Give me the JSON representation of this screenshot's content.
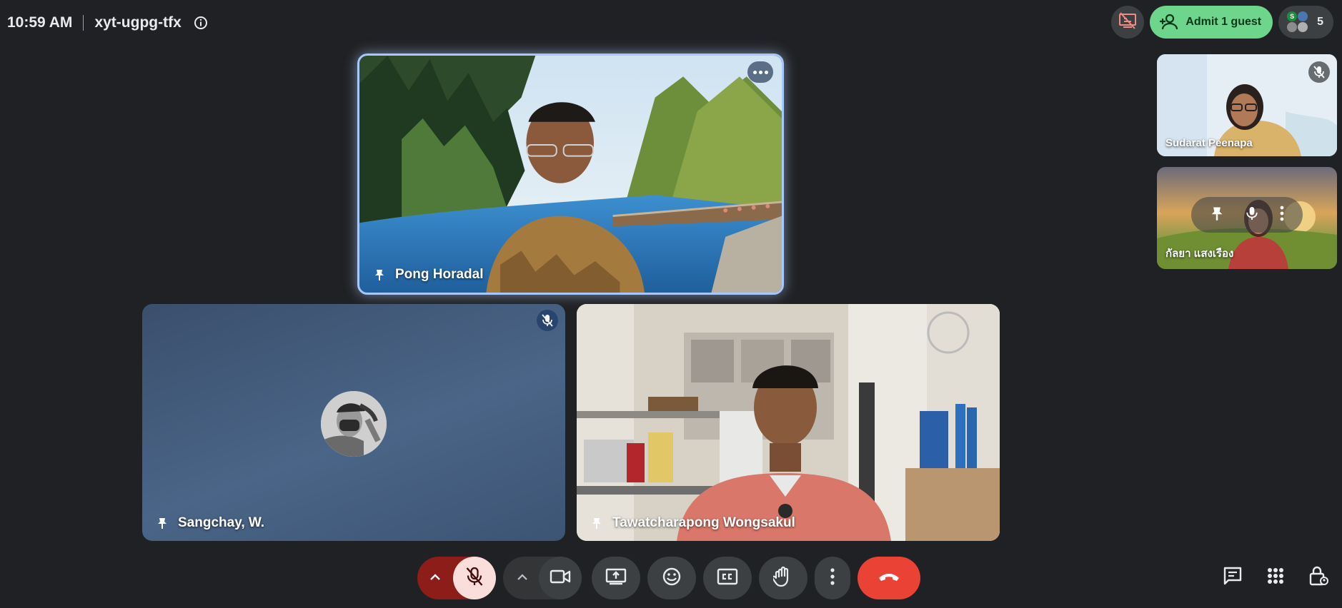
{
  "meeting": {
    "time": "10:59 AM",
    "code": "xyt-ugpg-tfx"
  },
  "header": {
    "admit_label": "Admit 1 guest",
    "participant_count": "5",
    "mini_avatar_letter": "S"
  },
  "tiles": {
    "main": {
      "name": "Pong Horadal"
    },
    "left": {
      "name": "Sangchay, W."
    },
    "right": {
      "name": "Tawatcharapong Wongsakul"
    }
  },
  "sidebar_tiles": [
    {
      "name": "Sudarat Peenapa"
    },
    {
      "name": "กัลยา แสงเรือง"
    }
  ],
  "colors": {
    "background": "#202124",
    "admit_green": "#6dd58c",
    "mic_off_bg": "#f9dedc",
    "mic_off_dark": "#8c1d18",
    "end_call_red": "#ea4335",
    "active_speaker_border": "#a8c7fa"
  }
}
